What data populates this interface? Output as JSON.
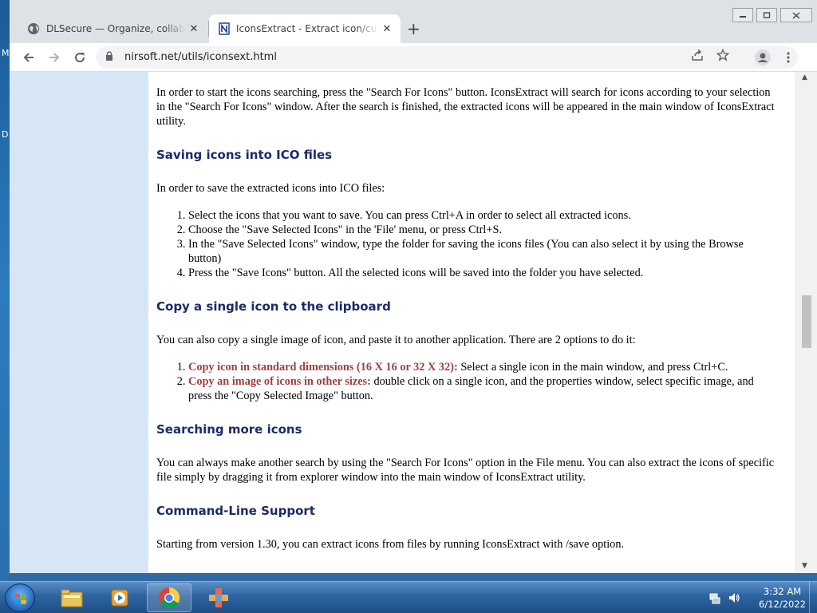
{
  "desktop": {
    "glyph_m": "M",
    "glyph_d": "D"
  },
  "browser": {
    "tabs": [
      {
        "title": "DLSecure — Organize, collaborate",
        "icon": "globe-icon"
      },
      {
        "title": "IconsExtract - Extract icon/cursor",
        "icon": "nirsoft-icon"
      }
    ],
    "tab_close": "✕",
    "new_tab": "+",
    "url": "nirsoft.net/utils/iconsext.html"
  },
  "page": {
    "intro": "In order to start the icons searching, press the \"Search For Icons\" button. IconsExtract will search for icons according to your selection in the \"Search For Icons\" window. After the search is finished, the extracted icons will be appeared in the main window of IconsExtract utility.",
    "save_heading": "Saving icons into ICO files",
    "save_intro": "In order to save the extracted icons into ICO files:",
    "save_steps": [
      "Select the icons that you want to save. You can press Ctrl+A in order to select all extracted icons.",
      "Choose the \"Save Selected Icons\" in the 'File' menu, or press Ctrl+S.",
      "In the \"Save Selected Icons\" window, type the folder for saving the icons files (You can also select it by using the Browse button)",
      "Press the \"Save Icons\" button. All the selected icons will be saved into the folder you have selected."
    ],
    "copy_heading": "Copy a single icon to the clipboard",
    "copy_intro": "You can also copy a single image of icon, and paste it to another application. There are 2 options to do it:",
    "copy_options": [
      {
        "title": "Copy icon in standard dimensions (16 X 16 or 32 X 32):",
        "text": " Select a single icon in the main window, and press Ctrl+C."
      },
      {
        "title": "Copy an image of icons in other sizes:",
        "text": " double click on a single icon, and the properties window, select specific image, and press the \"Copy Selected Image\" button."
      }
    ],
    "search_heading": "Searching more icons",
    "search_text": "You can always make another search by using the \"Search For Icons\" option in the File menu. You can also extract the icons of specific file simply by dragging it from explorer window into the main window of IconsExtract utility.",
    "cmd_heading": "Command-Line Support",
    "cmd_text": "Starting from version 1.30, you can extract icons from files by running IconsExtract with /save option."
  },
  "taskbar": {
    "time": "3:32 AM",
    "date": "6/12/2022"
  },
  "colors": {
    "sidebar": "#d7e6f7",
    "heading": "#1b2a6b",
    "highlight": "#a0403b"
  }
}
